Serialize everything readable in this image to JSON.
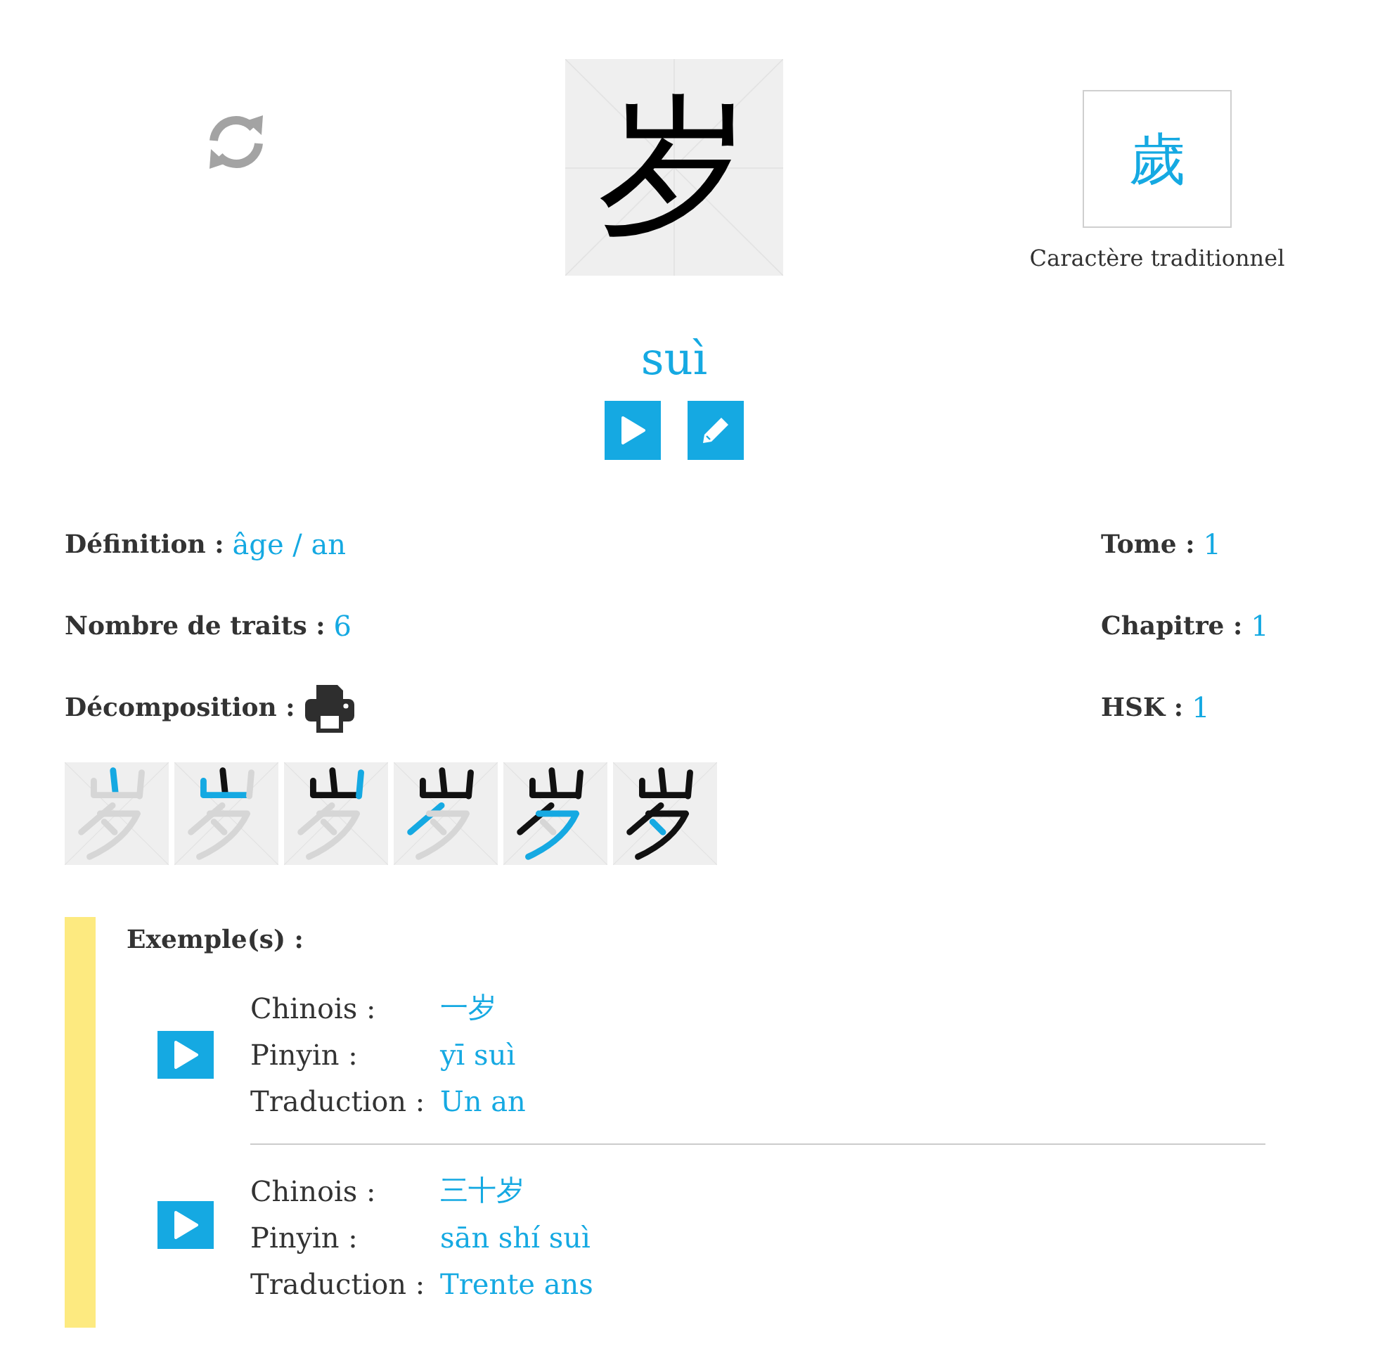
{
  "character": {
    "simplified": "岁",
    "pinyin": "suì",
    "traditional": "歲",
    "traditional_label": "Caractère traditionnel"
  },
  "info": {
    "left": [
      {
        "kind": "text",
        "label": "Définition :",
        "value": "âge / an"
      },
      {
        "kind": "text",
        "label": "Nombre de traits :",
        "value": "6"
      },
      {
        "kind": "print",
        "label": "Décomposition :"
      }
    ],
    "right": [
      {
        "kind": "text",
        "label": "Tome :",
        "value": "1"
      },
      {
        "kind": "text",
        "label": "Chapitre :",
        "value": "1"
      },
      {
        "kind": "text",
        "label": "HSK :",
        "value": "1"
      }
    ]
  },
  "decomposition": {
    "frames": [
      {
        "strokes": [
          {
            "drawn": true,
            "highlighted": true
          },
          {
            "drawn": false,
            "highlighted": false
          },
          {
            "drawn": false,
            "highlighted": false
          },
          {
            "drawn": false,
            "highlighted": false
          },
          {
            "drawn": false,
            "highlighted": false
          },
          {
            "drawn": false,
            "highlighted": false
          }
        ]
      },
      {
        "strokes": [
          {
            "drawn": true,
            "highlighted": false
          },
          {
            "drawn": true,
            "highlighted": true
          },
          {
            "drawn": false,
            "highlighted": false
          },
          {
            "drawn": false,
            "highlighted": false
          },
          {
            "drawn": false,
            "highlighted": false
          },
          {
            "drawn": false,
            "highlighted": false
          }
        ]
      },
      {
        "strokes": [
          {
            "drawn": true,
            "highlighted": false
          },
          {
            "drawn": true,
            "highlighted": false
          },
          {
            "drawn": true,
            "highlighted": true
          },
          {
            "drawn": false,
            "highlighted": false
          },
          {
            "drawn": false,
            "highlighted": false
          },
          {
            "drawn": false,
            "highlighted": false
          }
        ]
      },
      {
        "strokes": [
          {
            "drawn": true,
            "highlighted": false
          },
          {
            "drawn": true,
            "highlighted": false
          },
          {
            "drawn": true,
            "highlighted": false
          },
          {
            "drawn": true,
            "highlighted": true
          },
          {
            "drawn": false,
            "highlighted": false
          },
          {
            "drawn": false,
            "highlighted": false
          }
        ]
      },
      {
        "strokes": [
          {
            "drawn": true,
            "highlighted": false
          },
          {
            "drawn": true,
            "highlighted": false
          },
          {
            "drawn": true,
            "highlighted": false
          },
          {
            "drawn": true,
            "highlighted": false
          },
          {
            "drawn": true,
            "highlighted": true
          },
          {
            "drawn": false,
            "highlighted": false
          }
        ]
      },
      {
        "strokes": [
          {
            "drawn": true,
            "highlighted": false
          },
          {
            "drawn": true,
            "highlighted": false
          },
          {
            "drawn": true,
            "highlighted": false
          },
          {
            "drawn": true,
            "highlighted": false
          },
          {
            "drawn": true,
            "highlighted": false
          },
          {
            "drawn": true,
            "highlighted": true
          }
        ]
      }
    ]
  },
  "examples": {
    "title": "Exemple(s) :",
    "items": [
      {
        "chinese_label": "Chinois :",
        "chinese": "一岁",
        "pinyin_label": "Pinyin :",
        "pinyin": "yī suì",
        "translation_label": "Traduction :",
        "translation": "Un an"
      },
      {
        "chinese_label": "Chinois :",
        "chinese": "三十岁",
        "pinyin_label": "Pinyin :",
        "pinyin": "sān shí suì",
        "translation_label": "Traduction :",
        "translation": "Trente ans"
      }
    ]
  }
}
